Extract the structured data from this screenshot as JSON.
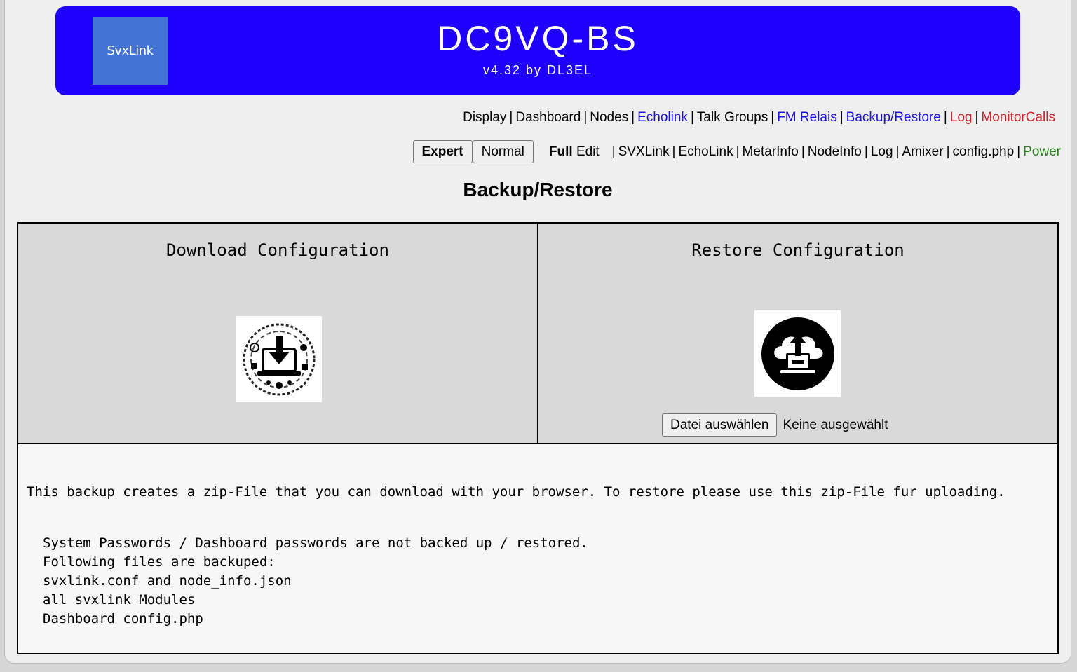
{
  "header": {
    "logo_text": "SvxLink",
    "title": "DC9VQ-BS",
    "subtitle": "v4.32 by DL3EL"
  },
  "nav_primary": [
    {
      "label": "Display",
      "color": "default"
    },
    {
      "label": "Dashboard",
      "color": "default"
    },
    {
      "label": "Nodes",
      "color": "default"
    },
    {
      "label": "Echolink",
      "color": "blue"
    },
    {
      "label": "Talk Groups",
      "color": "default"
    },
    {
      "label": "FM Relais",
      "color": "blue"
    },
    {
      "label": "Backup/Restore",
      "color": "blue"
    },
    {
      "label": "Log",
      "color": "red"
    },
    {
      "label": "MonitorCalls",
      "color": "red"
    }
  ],
  "mode": {
    "expert_label": "Expert",
    "normal_label": "Normal",
    "active": "Expert"
  },
  "edit": {
    "full_label": "Full",
    "edit_label": "Edit"
  },
  "nav_secondary": [
    {
      "label": "SVXLink",
      "color": "default"
    },
    {
      "label": "EchoLink",
      "color": "default"
    },
    {
      "label": "MetarInfo",
      "color": "default"
    },
    {
      "label": "NodeInfo",
      "color": "default"
    },
    {
      "label": "Log",
      "color": "default"
    },
    {
      "label": "Amixer",
      "color": "default"
    },
    {
      "label": "config.php",
      "color": "default"
    },
    {
      "label": "Power",
      "color": "green"
    }
  ],
  "page_title": "Backup/Restore",
  "download": {
    "title": "Download Configuration",
    "icon": "download-icon"
  },
  "restore": {
    "title": "Restore Configuration",
    "icon": "cloud-upload-icon",
    "file_button": "Datei auswählen",
    "file_status": "Keine ausgewählt"
  },
  "info_text": "This backup creates a zip-File that you can download with your browser. To restore please use this zip-File fur uploading.",
  "notes": [
    "System Passwords / Dashboard passwords are not backed up / restored.",
    "Following files are backuped:",
    "svxlink.conf and node_info.json",
    "all svxlink Modules",
    "Dashboard config.php"
  ],
  "colors": {
    "banner": "#1f00ff",
    "logo_bg": "#4473d6",
    "link_blue": "#1d10e8",
    "link_red": "#d1202a",
    "link_green": "#27801c"
  }
}
